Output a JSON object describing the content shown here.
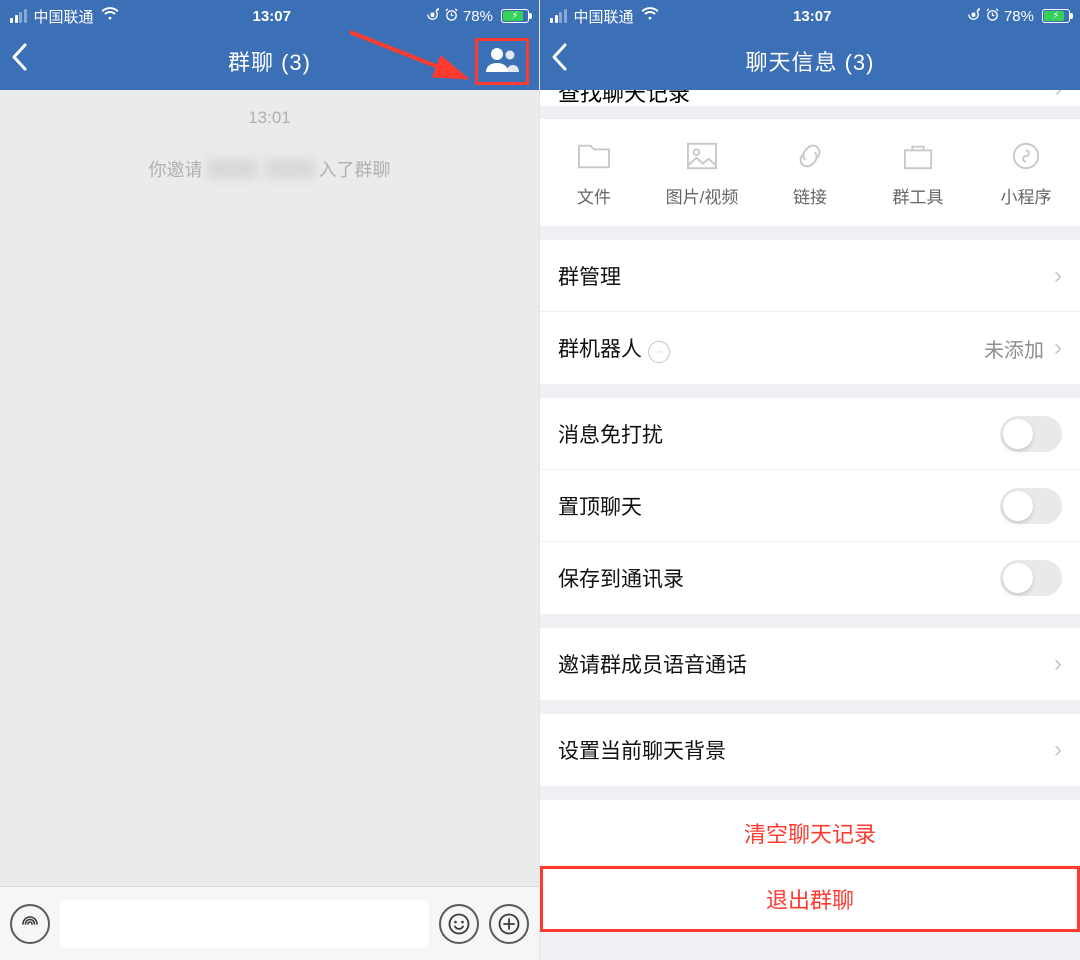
{
  "status": {
    "carrier": "中国联通",
    "time": "13:07",
    "battery_pct": "78%"
  },
  "left": {
    "title": "群聊 (3)",
    "timestamp": "13:01",
    "system_prefix": "你邀请",
    "system_suffix": "入了群聊"
  },
  "right": {
    "title": "聊天信息 (3)",
    "peek": "查找聊天记录",
    "media": {
      "files": "文件",
      "images": "图片/视频",
      "links": "链接",
      "tools": "群工具",
      "mini": "小程序"
    },
    "manage": "群管理",
    "bot": "群机器人",
    "bot_value": "未添加",
    "dnd": "消息免打扰",
    "pin": "置顶聊天",
    "save_contacts": "保存到通讯录",
    "voice_invite": "邀请群成员语音通话",
    "set_bg": "设置当前聊天背景",
    "clear": "清空聊天记录",
    "leave": "退出群聊"
  }
}
